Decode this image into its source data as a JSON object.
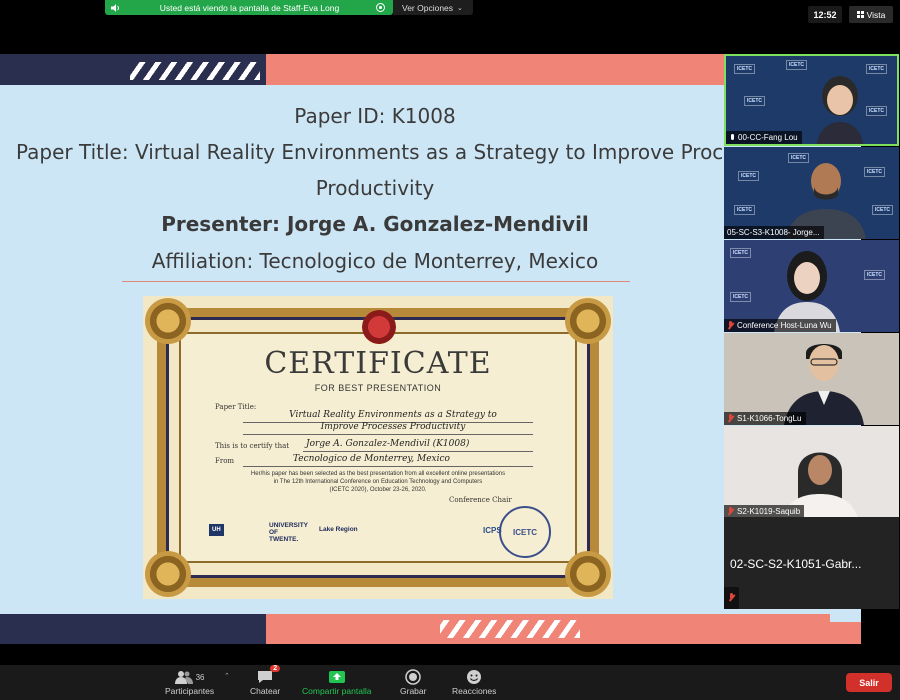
{
  "top_bar": {
    "share_banner": "Usted está viendo la pantalla de Staff-Eva Long",
    "view_options": "Ver Opciones",
    "clock": "12:52",
    "view_button": "Vista"
  },
  "slide": {
    "paper_id": "Paper ID: K1008",
    "paper_title_line1": "Paper Title: Virtual Reality Environments as a Strategy to Improve Processes",
    "paper_title_line2": "Productivity",
    "presenter": "Presenter: Jorge A. Gonzalez-Mendivil",
    "affiliation": "Affiliation: Tecnologico de Monterrey, Mexico"
  },
  "certificate": {
    "title": "CERTIFICATE",
    "subtitle": "FOR BEST PRESENTATION",
    "paper_title_label": "Paper Title:",
    "paper_title_1": "Virtual Reality Environments as a Strategy to",
    "paper_title_2": "Improve Processes Productivity",
    "certify_label": "This is to certify that",
    "recipient": "Jorge A. Gonzalez-Mendivil (K1008)",
    "from_label": "From",
    "institution": "Tecnologico de Monterrey, Mexico",
    "body_1": "Her/his paper has been selected as the best presentation from all excellent online presentations",
    "body_2": "in The 12th International Conference on Education Technology and Computers",
    "body_3": "(ICETC 2020), October 23-26, 2020.",
    "chair_label": "Conference Chair",
    "stamp": "ICETC",
    "logos": [
      "UH",
      "UNIVERSITY OF TWENTE.",
      "Lake Region",
      "ICPS"
    ]
  },
  "participants": [
    {
      "name": "00-CC-Fang Lou",
      "muted": false,
      "active": true
    },
    {
      "name": "05-SC-S3-K1008- Jorge...",
      "muted": false,
      "active": false
    },
    {
      "name": "Conference Host-Luna Wu",
      "muted": true,
      "active": false
    },
    {
      "name": "S1-K1066-TongLu",
      "muted": true,
      "active": false
    },
    {
      "name": "S2-K1019-Saquib",
      "muted": true,
      "active": false
    },
    {
      "name": "02-SC-S2-K1051-Gabr...",
      "muted": true,
      "active": false
    }
  ],
  "toolbar": {
    "participants_label": "Participantes",
    "participants_count": "36",
    "chat_label": "Chatear",
    "chat_badge": "2",
    "share_label": "Compartir pantalla",
    "record_label": "Grabar",
    "reactions_label": "Reacciones",
    "leave_label": "Salir"
  },
  "colors": {
    "slide_bg": "#cde6f5",
    "accent_coral": "#f08477",
    "navy": "#2b2f4f",
    "share_green": "#23a64a",
    "leave_red": "#d2302a"
  }
}
